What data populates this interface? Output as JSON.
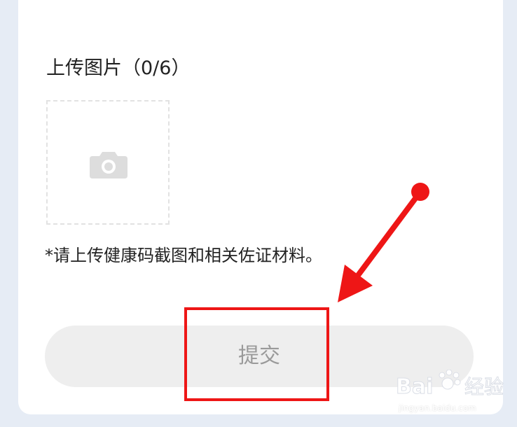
{
  "upload": {
    "title": "上传图片（0/6）",
    "camera_icon": "camera-icon"
  },
  "hint": "*请上传健康码截图和相关佐证材料。",
  "submit": {
    "label": "提交"
  },
  "annotation": {
    "color": "#ee1616",
    "arrow_icon": "arrow-icon"
  },
  "watermark": {
    "logo_text": "Bai 经验",
    "url": "jingyan.baidu.com"
  },
  "colors": {
    "background": "#e6ecf5",
    "card": "#ffffff",
    "button_bg": "#eeeeee",
    "button_text": "#9a9a9a",
    "text": "#222222"
  }
}
